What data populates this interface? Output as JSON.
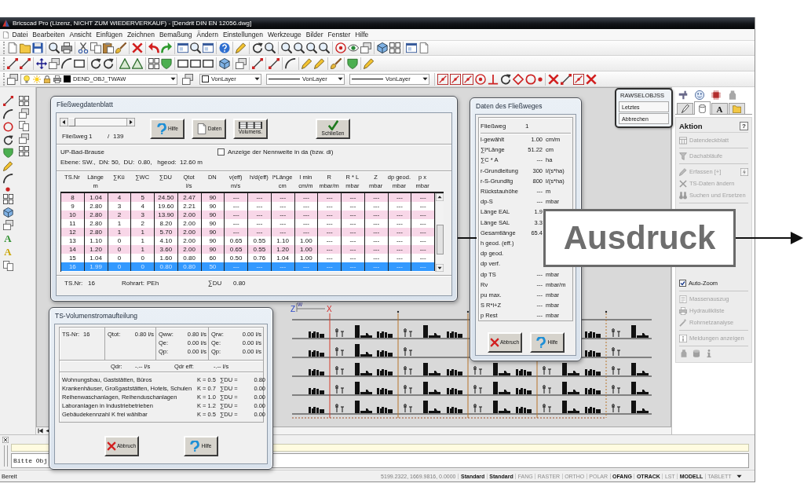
{
  "window": {
    "title": "Bricscad Pro (Lizenz, NICHT ZUM WIEDERVERKAUF) - [Dendrit DIN EN 12056.dwg]"
  },
  "menu": [
    "Datei",
    "Bearbeiten",
    "Ansicht",
    "Einfügen",
    "Zeichnen",
    "Bemaßung",
    "Ändern",
    "Einstellungen",
    "Werkzeuge",
    "Bilder",
    "Fenster",
    "Hilfe"
  ],
  "layer_toolbar": {
    "dropdowns": [
      {
        "kind": "layer",
        "value": "DEND_OBJ_TWAW"
      },
      {
        "kind": "swatch",
        "value": "VonLayer"
      },
      {
        "kind": "linetype",
        "value": "VonLayer"
      },
      {
        "kind": "lineweight",
        "value": "VonLayer"
      }
    ]
  },
  "left_toolbar": {
    "text_tools": [
      {
        "label": "A",
        "color": "#2f8f2f"
      },
      {
        "label": "A",
        "color": "#c9a400"
      }
    ]
  },
  "ucs_icon": {
    "labels": [
      "Z",
      "W",
      "X"
    ]
  },
  "flow_sheet": {
    "title": "Fließwegdatenblatt",
    "navigator": {
      "level": 0,
      "label": "Fließweg",
      "current": "1",
      "separator": "/",
      "total": "139"
    },
    "buttons": [
      {
        "kind": "help",
        "label": "Hilfe"
      },
      {
        "kind": "data",
        "label": "Daten"
      },
      {
        "kind": "volume",
        "label": "Volumens."
      },
      {
        "kind": "close",
        "label": "Schließen"
      }
    ],
    "object": "UP-Bad-Brause",
    "details": "Ebene: SW.,  DN: 50,  DU:  0.80,   hgeod:  12.60 m",
    "nominal_size_option": {
      "label": "Anzeige der Nennweite in da (bzw. di)",
      "checked": false
    },
    "table": {
      "columns": [
        {
          "name": "TS.Nr"
        },
        {
          "name": "Länge",
          "unit": "m"
        },
        {
          "name": "∑Kü"
        },
        {
          "name": "∑WC"
        },
        {
          "name": "∑DU"
        },
        {
          "name": "Qtot",
          "unit": "l/s"
        },
        {
          "name": "DN"
        },
        {
          "name": "v(eff)",
          "unit": "m/s"
        },
        {
          "name": "h/d(eff)"
        },
        {
          "name": "l*Länge",
          "unit": "cm"
        },
        {
          "name": "I min",
          "unit": "cm/m"
        },
        {
          "name": "R",
          "unit": "mbar/m"
        },
        {
          "name": "R * L",
          "unit": "mbar"
        },
        {
          "name": "Z",
          "unit": "mbar"
        },
        {
          "name": "dp geod.",
          "unit": "mbar"
        },
        {
          "name": "p x",
          "unit": "mbar"
        }
      ],
      "rows": [
        {
          "selected": false,
          "cells": [
            "8",
            "1.04",
            "4",
            "5",
            "24.50",
            "2.47",
            "90",
            "---",
            "---",
            "---",
            "---",
            "---",
            "---",
            "---",
            "---",
            "---"
          ]
        },
        {
          "selected": false,
          "cells": [
            "9",
            "2.80",
            "3",
            "4",
            "19.60",
            "2.21",
            "90",
            "---",
            "---",
            "---",
            "---",
            "---",
            "---",
            "---",
            "---",
            "---"
          ]
        },
        {
          "selected": false,
          "cells": [
            "10",
            "2.80",
            "2",
            "3",
            "13.90",
            "2.00",
            "90",
            "---",
            "---",
            "---",
            "---",
            "---",
            "---",
            "---",
            "---",
            "---"
          ]
        },
        {
          "selected": false,
          "cells": [
            "11",
            "2.80",
            "1",
            "2",
            "8.20",
            "2.00",
            "90",
            "---",
            "---",
            "---",
            "---",
            "---",
            "---",
            "---",
            "---",
            "---"
          ]
        },
        {
          "selected": false,
          "cells": [
            "12",
            "2.80",
            "1",
            "1",
            "5.70",
            "2.00",
            "90",
            "---",
            "---",
            "---",
            "---",
            "---",
            "---",
            "---",
            "---",
            "---"
          ]
        },
        {
          "selected": false,
          "cells": [
            "13",
            "1.10",
            "0",
            "1",
            "4.10",
            "2.00",
            "90",
            "0.65",
            "0.55",
            "1.10",
            "1.00",
            "---",
            "---",
            "---",
            "---",
            "---"
          ]
        },
        {
          "selected": false,
          "cells": [
            "14",
            "1.20",
            "0",
            "1",
            "3.60",
            "2.00",
            "90",
            "0.65",
            "0.55",
            "1.20",
            "1.00",
            "---",
            "---",
            "---",
            "---",
            "---"
          ]
        },
        {
          "selected": false,
          "cells": [
            "15",
            "1.04",
            "0",
            "0",
            "1.60",
            "0.80",
            "60",
            "0.50",
            "0.76",
            "1.04",
            "1.00",
            "---",
            "---",
            "---",
            "---",
            "---"
          ]
        },
        {
          "selected": true,
          "cells": [
            "16",
            "1.99",
            "0",
            "0",
            "0.80",
            "0.80",
            "50",
            "---",
            "---",
            "---",
            "---",
            "---",
            "---",
            "---",
            "---",
            "---"
          ]
        }
      ]
    },
    "footer": [
      {
        "label": "TS.Nr:",
        "value": "16"
      },
      {
        "label": "Rohrart:",
        "value": "PEh"
      },
      {
        "label": "∑DU",
        "value": "0.80"
      }
    ]
  },
  "flow_path_data": {
    "title": "Daten des Fließweges",
    "header": {
      "label": "Fließweg",
      "value": "1"
    },
    "rows": [
      {
        "label": "l-gewählt",
        "value": "1.00",
        "unit": "cm/m"
      },
      {
        "label": "∑l*Länge",
        "value": "51.22",
        "unit": "cm"
      },
      {
        "label": "∑C * A",
        "value": "---",
        "unit": "ha"
      },
      {
        "label": "r-Grundleitung",
        "value": "300",
        "unit": "l/(s*ha)"
      },
      {
        "label": "r-S-Grundltg",
        "value": "800",
        "unit": "l/(s*ha)"
      },
      {
        "label": "Rückstauhöhe",
        "value": "---",
        "unit": "m"
      },
      {
        "label": "dp-S",
        "value": "---",
        "unit": "mbar"
      },
      {
        "label": "Länge EAL",
        "value": "1.9"
      },
      {
        "label": "Länge SAL",
        "value": "3.3"
      },
      {
        "label": "Gesamtlänge",
        "value": "65.4"
      },
      {
        "label": "h geod. (eff.)"
      },
      {
        "label": "dp geod."
      },
      {
        "label": "dp verf."
      },
      {
        "label": "dp TS",
        "value": "---",
        "unit": "mbar"
      },
      {
        "label": "Rv",
        "value": "---",
        "unit": "mbar/m"
      },
      {
        "label": "pu max.",
        "value": "---",
        "unit": "mbar"
      },
      {
        "label": "S R*l+Z",
        "value": "---",
        "unit": "mbar"
      },
      {
        "label": "p Rest",
        "value": "---",
        "unit": "mbar"
      }
    ],
    "buttons": [
      {
        "kind": "cancel",
        "label": "Abbruch"
      },
      {
        "kind": "help",
        "label": "Hilfe"
      }
    ]
  },
  "volume_split": {
    "title": "TS-Volumenstromaufteilung",
    "ts": {
      "label": "TS-Nr:",
      "value": "16"
    },
    "total": {
      "label": "Qtot:",
      "value": "0.80 l/s"
    },
    "flows_a": [
      {
        "label": "Qww:",
        "value": "0.80 l/s"
      },
      {
        "label": "Qe:",
        "value": "0.00 l/s"
      },
      {
        "label": "Qp:",
        "value": "0.00 l/s"
      }
    ],
    "flows_b": [
      {
        "label": "Qrw:",
        "value": "0.00 l/s"
      },
      {
        "label": "Qe:",
        "value": "0.00 l/s"
      },
      {
        "label": "Qp:",
        "value": "0.00 l/s"
      }
    ],
    "drain": [
      {
        "label": "Qdr:",
        "value": "-.-- l/s"
      },
      {
        "label": "Qdr eff:",
        "value": "-.-- l/s"
      }
    ],
    "categories": [
      {
        "name": "Wohnungsbau, Gaststätten, Büros",
        "k": "K = 0.5",
        "sum_label": "∑DU =",
        "sum": "0.80"
      },
      {
        "name": "Krankenhäuser, Großgaststätten, Hotels, Schulen",
        "k": "K = 0.7",
        "sum_label": "∑DU =",
        "sum": "0.00"
      },
      {
        "name": "Reihenwaschanlagen, Reihenduschanlagen",
        "k": "K = 1.0",
        "sum_label": "∑DU =",
        "sum": "0.00"
      },
      {
        "name": "Laboranlagen in Industriebetrieben",
        "k": "K = 1.2",
        "sum_label": "∑DU =",
        "sum": "0.00"
      },
      {
        "name": "Gebäudekennzahl K frei wählbar",
        "k": "K = 0.5",
        "sum_label": "∑DU =",
        "sum": "0.00"
      }
    ],
    "buttons": [
      {
        "kind": "cancel",
        "label": "Abbruch"
      },
      {
        "kind": "help",
        "label": "Hilfe"
      }
    ]
  },
  "selection_popup": {
    "title": "RAWSELOBJSS",
    "options": [
      "Letztes",
      "Abbrechen"
    ]
  },
  "side_panel": {
    "tabs": [
      {
        "selected": false
      },
      {
        "selected": true
      },
      {
        "label": "A",
        "selected": false
      },
      {
        "selected": false
      }
    ],
    "section": {
      "title": "Aktion",
      "help_label": "?",
      "upper": [
        {
          "items": [
            {
              "kind": "command",
              "label": "Datendeckblatt",
              "disabled": true
            }
          ]
        },
        {
          "items": [
            {
              "kind": "command",
              "label": "Dachabläufe",
              "disabled": true
            }
          ]
        },
        {
          "items": [
            {
              "kind": "command",
              "label": "Erfassen [+]",
              "disabled": true,
              "extra_button": true
            },
            {
              "kind": "command",
              "label": "TS-Daten ändern",
              "disabled": true
            },
            {
              "kind": "command",
              "label": "Suchen und Ersetzen",
              "disabled": true
            }
          ]
        }
      ],
      "lower": [
        {
          "items": [
            {
              "kind": "checkbox",
              "label": "Auto-Zoom",
              "disabled": false,
              "checked": true
            }
          ]
        },
        {
          "items": [
            {
              "kind": "command",
              "label": "Massenauszug",
              "disabled": true
            },
            {
              "kind": "command",
              "label": "Hydraulikliste",
              "disabled": true
            },
            {
              "kind": "command",
              "label": "Rohrnetzanalyse",
              "disabled": true
            }
          ]
        },
        {
          "items": [
            {
              "kind": "command",
              "label": "Meldungen anzeigen",
              "disabled": true
            }
          ]
        }
      ]
    }
  },
  "command_line": {
    "prompt": "Bitte Obj"
  },
  "status_bar": {
    "message": "Bereit",
    "coordinates": "5199.2322, 1669.9816, 0.0000",
    "styles": [
      "Standard",
      "Standard"
    ],
    "toggles": [
      {
        "label": "FANG",
        "on": false
      },
      {
        "label": "RASTER",
        "on": false
      },
      {
        "label": "ORTHO",
        "on": false
      },
      {
        "label": "POLAR",
        "on": false
      },
      {
        "label": "OFANG",
        "on": true
      },
      {
        "label": "OTRACK",
        "on": true
      },
      {
        "label": "LST",
        "on": false
      },
      {
        "label": "MODELL",
        "on": true
      },
      {
        "label": "TABLETT",
        "on": false
      }
    ]
  },
  "annotation": {
    "label": "Ausdruck"
  }
}
